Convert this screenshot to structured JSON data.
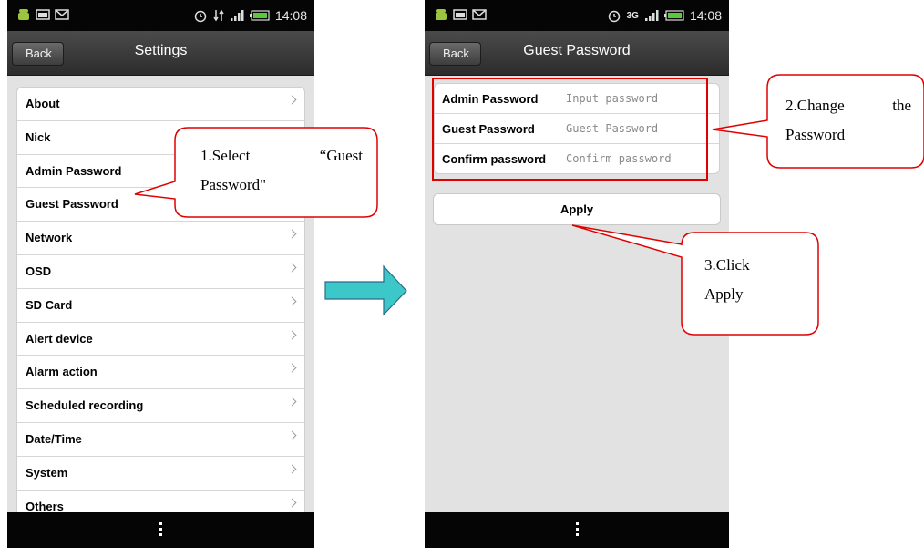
{
  "left_screen": {
    "status_time": "14:08",
    "back_label": "Back",
    "title": "Settings",
    "items": [
      {
        "label": "About"
      },
      {
        "label": "Nick"
      },
      {
        "label": "Admin Password"
      },
      {
        "label": "Guest Password"
      },
      {
        "label": "Network"
      },
      {
        "label": "OSD"
      },
      {
        "label": "SD Card"
      },
      {
        "label": "Alert device"
      },
      {
        "label": "Alarm action"
      },
      {
        "label": "Scheduled recording"
      },
      {
        "label": "Date/Time"
      },
      {
        "label": "System"
      },
      {
        "label": "Others"
      }
    ]
  },
  "right_screen": {
    "status_time": "14:08",
    "network_type": "3G",
    "back_label": "Back",
    "title": "Guest Password",
    "fields": [
      {
        "label": "Admin Password",
        "placeholder": "Input password"
      },
      {
        "label": "Guest Password",
        "placeholder": "Guest Password"
      },
      {
        "label": "Confirm password",
        "placeholder": "Confirm password"
      }
    ],
    "apply_label": "Apply"
  },
  "annotations": {
    "step1_line1_a": "1.Select",
    "step1_line1_b": "“Guest",
    "step1_line2": "Password\"",
    "step2_line1_a": "2.Change",
    "step2_line1_b": "the",
    "step2_line2": "Password",
    "step3_line1": "3.Click",
    "step3_line2": "Apply"
  },
  "colors": {
    "highlight": "#e00000",
    "arrow_fill": "#3cc8c8",
    "arrow_stroke": "#2a6a8a"
  }
}
